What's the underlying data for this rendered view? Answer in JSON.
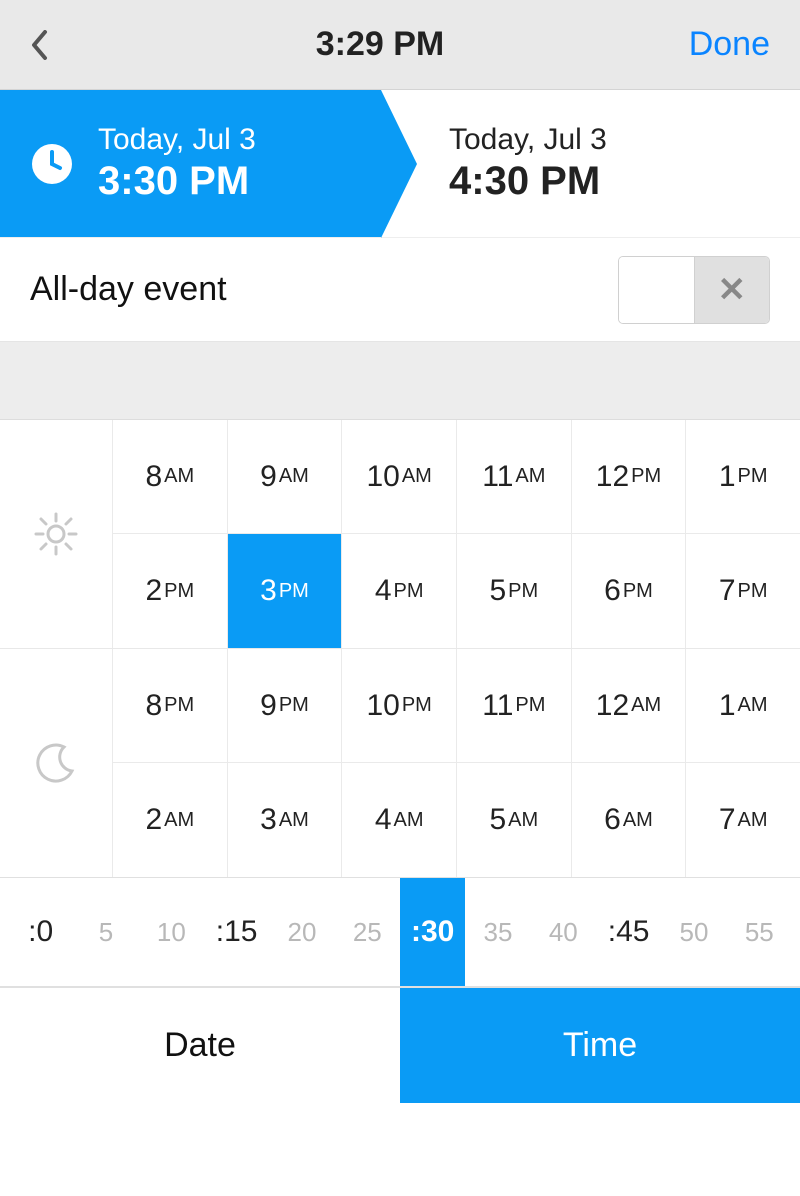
{
  "header": {
    "title": "3:29 PM",
    "done": "Done"
  },
  "range": {
    "start": {
      "date": "Today, Jul 3",
      "time": "3:30 PM"
    },
    "end": {
      "date": "Today, Jul 3",
      "time": "4:30 PM"
    }
  },
  "allday": {
    "label": "All-day event",
    "x": "✕"
  },
  "hours": {
    "day": [
      {
        "h": "8",
        "p": "AM"
      },
      {
        "h": "9",
        "p": "AM"
      },
      {
        "h": "10",
        "p": "AM"
      },
      {
        "h": "11",
        "p": "AM"
      },
      {
        "h": "12",
        "p": "PM"
      },
      {
        "h": "1",
        "p": "PM"
      },
      {
        "h": "2",
        "p": "PM"
      },
      {
        "h": "3",
        "p": "PM"
      },
      {
        "h": "4",
        "p": "PM"
      },
      {
        "h": "5",
        "p": "PM"
      },
      {
        "h": "6",
        "p": "PM"
      },
      {
        "h": "7",
        "p": "PM"
      }
    ],
    "night": [
      {
        "h": "8",
        "p": "PM"
      },
      {
        "h": "9",
        "p": "PM"
      },
      {
        "h": "10",
        "p": "PM"
      },
      {
        "h": "11",
        "p": "PM"
      },
      {
        "h": "12",
        "p": "AM"
      },
      {
        "h": "1",
        "p": "AM"
      },
      {
        "h": "2",
        "p": "AM"
      },
      {
        "h": "3",
        "p": "AM"
      },
      {
        "h": "4",
        "p": "AM"
      },
      {
        "h": "5",
        "p": "AM"
      },
      {
        "h": "6",
        "p": "AM"
      },
      {
        "h": "7",
        "p": "AM"
      }
    ],
    "selected_day_index": 7
  },
  "minutes": {
    "items": [
      {
        "label": ":0",
        "major": true
      },
      {
        "label": "5",
        "major": false
      },
      {
        "label": "10",
        "major": false
      },
      {
        "label": ":15",
        "major": true
      },
      {
        "label": "20",
        "major": false
      },
      {
        "label": "25",
        "major": false
      },
      {
        "label": ":30",
        "major": true
      },
      {
        "label": "35",
        "major": false
      },
      {
        "label": "40",
        "major": false
      },
      {
        "label": ":45",
        "major": true
      },
      {
        "label": "50",
        "major": false
      },
      {
        "label": "55",
        "major": false
      }
    ],
    "selected_index": 6
  },
  "tabs": {
    "date": "Date",
    "time": "Time"
  },
  "colors": {
    "accent": "#0a9bf5",
    "link": "#0a84ff"
  }
}
